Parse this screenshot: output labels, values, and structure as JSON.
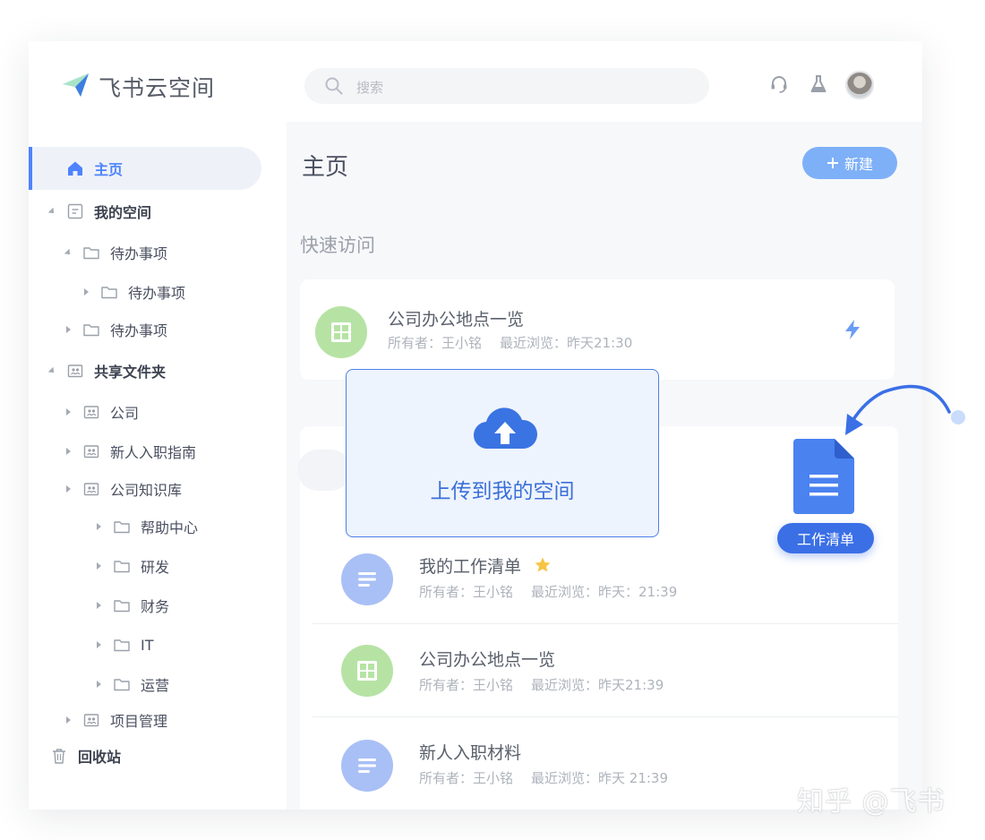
{
  "app": {
    "title": "飞书云空间"
  },
  "search": {
    "placeholder": "搜索"
  },
  "header_icons": [
    "headset-icon",
    "lab-flask-icon"
  ],
  "sidebar": {
    "home": "主页",
    "my_space": "我的空间",
    "my_space_items": [
      {
        "label": "待办事项",
        "child": "待办事项"
      },
      {
        "label": "待办事项"
      }
    ],
    "shared": "共享文件夹",
    "shared_items": [
      "公司",
      "新人入职指南",
      "公司知识库"
    ],
    "kb_items": [
      "帮助中心",
      "研发",
      "财务",
      "IT",
      "运营"
    ],
    "project": "项目管理",
    "trash": "回收站"
  },
  "main": {
    "title": "主页",
    "new_button": "新建",
    "quick_access_title": "快速访问",
    "quick_access": {
      "name": "公司办公地点一览",
      "owner": "所有者：王小铭",
      "viewed": "最近浏览：昨天21:30",
      "icon": "sheet-grid-icon"
    },
    "recent": [
      {
        "name": "我的工作清单",
        "owner": "所有者：王小铭",
        "viewed": "最近浏览：昨天：21:39",
        "starred": true,
        "icon": "doc-lines-icon"
      },
      {
        "name": "公司办公地点一览",
        "owner": "所有者：王小铭",
        "viewed": "最近浏览：昨天21:39",
        "icon": "sheet-grid-icon"
      },
      {
        "name": "新人入职材料",
        "owner": "所有者：王小铭",
        "viewed": "最近浏览：昨天 21:39",
        "icon": "doc-lines-icon"
      }
    ]
  },
  "upload_overlay": {
    "label": "上传到我的空间"
  },
  "drag_file": {
    "label": "工作清单"
  },
  "watermark": "知乎 @飞书",
  "colors": {
    "accent": "#4e83fd",
    "upload_border": "#4c7fe6",
    "sheet": "#b6e3a4",
    "doc": "#a9c0f6"
  }
}
